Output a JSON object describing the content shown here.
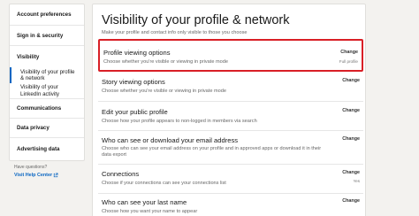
{
  "sidebar": {
    "items": [
      {
        "label": "Account preferences"
      },
      {
        "label": "Sign in & security"
      },
      {
        "label": "Visibility"
      },
      {
        "label": "Visibility of your profile & network"
      },
      {
        "label": "Visibility of your LinkedIn activity"
      },
      {
        "label": "Communications"
      },
      {
        "label": "Data privacy"
      },
      {
        "label": "Advertising data"
      }
    ]
  },
  "help": {
    "question": "Have questions?",
    "link": "Visit Help Center"
  },
  "main": {
    "title": "Visibility of your profile & network",
    "subtitle": "Make your profile and contact info only visible to those you choose",
    "rows": [
      {
        "title": "Profile viewing options",
        "desc": "Choose whether you're visible or viewing in private mode",
        "action": "Change",
        "value": "Full profile"
      },
      {
        "title": "Story viewing options",
        "desc": "Choose whether you're visible or viewing in private mode",
        "action": "Change",
        "value": ""
      },
      {
        "title": "Edit your public profile",
        "desc": "Choose how your profile appears to non-logged in members via search",
        "action": "Change",
        "value": ""
      },
      {
        "title": "Who can see or download your email address",
        "desc": "Choose who can see your email address on your profile and in approved apps or download it in their data export",
        "action": "Change",
        "value": ""
      },
      {
        "title": "Connections",
        "desc": "Choose if your connections can see your connections list",
        "action": "Change",
        "value": "Yes"
      },
      {
        "title": "Who can see your last name",
        "desc": "Choose how you want your name to appear",
        "action": "Change",
        "value": ""
      }
    ]
  },
  "colors": {
    "accent": "#0a66c2",
    "highlight": "#d91f26"
  }
}
